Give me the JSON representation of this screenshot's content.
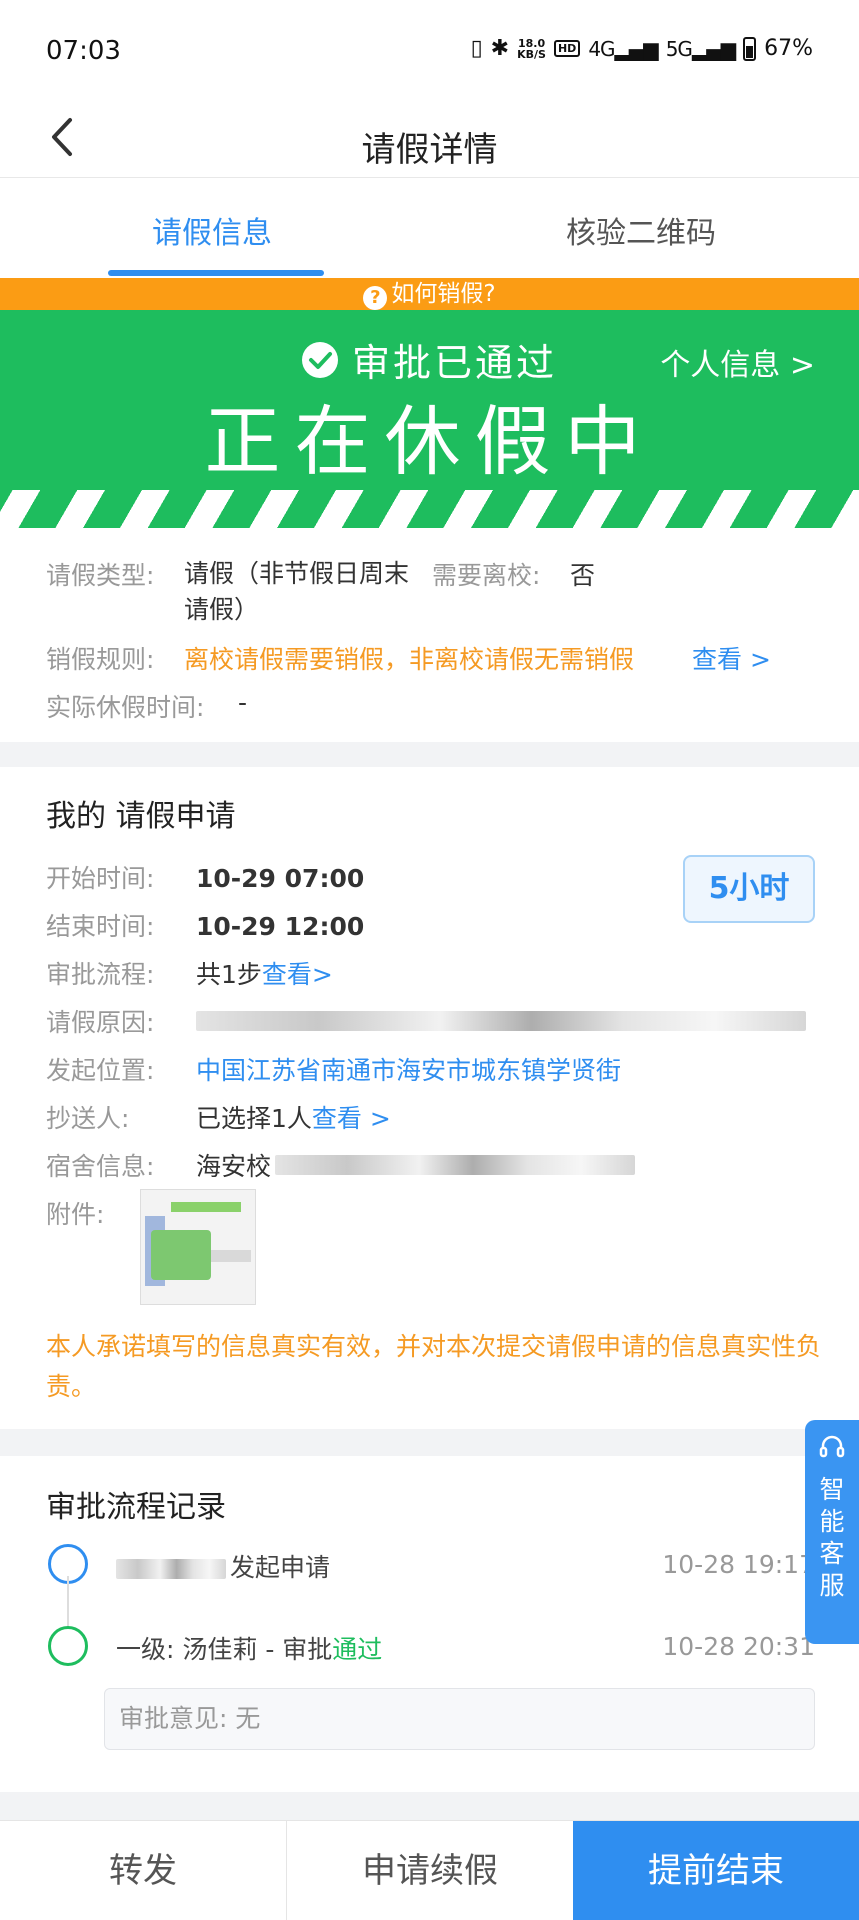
{
  "status_bar": {
    "time": "07:03",
    "net_speed_top": "18.0",
    "net_speed_unit": "KB/S",
    "hd_badge": "HD",
    "signal1": "4G",
    "signal2": "5G",
    "battery": "67%"
  },
  "nav": {
    "title": "请假详情"
  },
  "tabs": [
    {
      "label": "请假信息",
      "active": true
    },
    {
      "label": "核验二维码",
      "active": false
    }
  ],
  "banner": {
    "how_to_cancel": "如何销假?",
    "approved_text": "审批已通过",
    "personal_info": "个人信息 >",
    "big_status": "正在休假中"
  },
  "leave_info": {
    "type_label": "请假类型:",
    "type_value": "请假（非节假日周末请假）",
    "need_leave_school_label": "需要离校:",
    "need_leave_school_value": "否",
    "cancel_rule_label": "销假规则:",
    "cancel_rule_value": "离校请假需要销假，非离校请假无需销假",
    "cancel_rule_link": "查看 >",
    "actual_time_label": "实际休假时间:",
    "actual_time_value": "-"
  },
  "application": {
    "title": "我的 请假申请",
    "duration": "5小时",
    "start_label": "开始时间:",
    "start_value": "10-29 07:00",
    "end_label": "结束时间:",
    "end_value": "10-29 12:00",
    "process_label": "审批流程:",
    "process_value": "共1步",
    "process_link": "查看>",
    "reason_label": "请假原因:",
    "location_label": "发起位置:",
    "location_value": "中国江苏省南通市海安市城东镇学贤街",
    "cc_label": "抄送人:",
    "cc_value": "已选择1人",
    "cc_link": "查看 >",
    "dorm_label": "宿舍信息:",
    "dorm_value": "海安校",
    "attach_label": "附件:",
    "promise": "本人承诺填写的信息真实有效，并对本次提交请假申请的信息真实性负责。"
  },
  "flow": {
    "title": "审批流程记录",
    "step1_text": "发起申请",
    "step1_time": "10-28 19:17",
    "step2_text": "一级: 汤佳莉 - 审批",
    "step2_status": "通过",
    "step2_time": "10-28 20:31",
    "comment": "审批意见: 无"
  },
  "floating_service": {
    "label": "智能客服"
  },
  "bottom_actions": [
    {
      "label": "转发"
    },
    {
      "label": "申请续假"
    },
    {
      "label": "提前结束"
    }
  ],
  "colors": {
    "primary": "#2f8ef0",
    "green": "#1ebd5e",
    "orange": "#fb9c14"
  }
}
